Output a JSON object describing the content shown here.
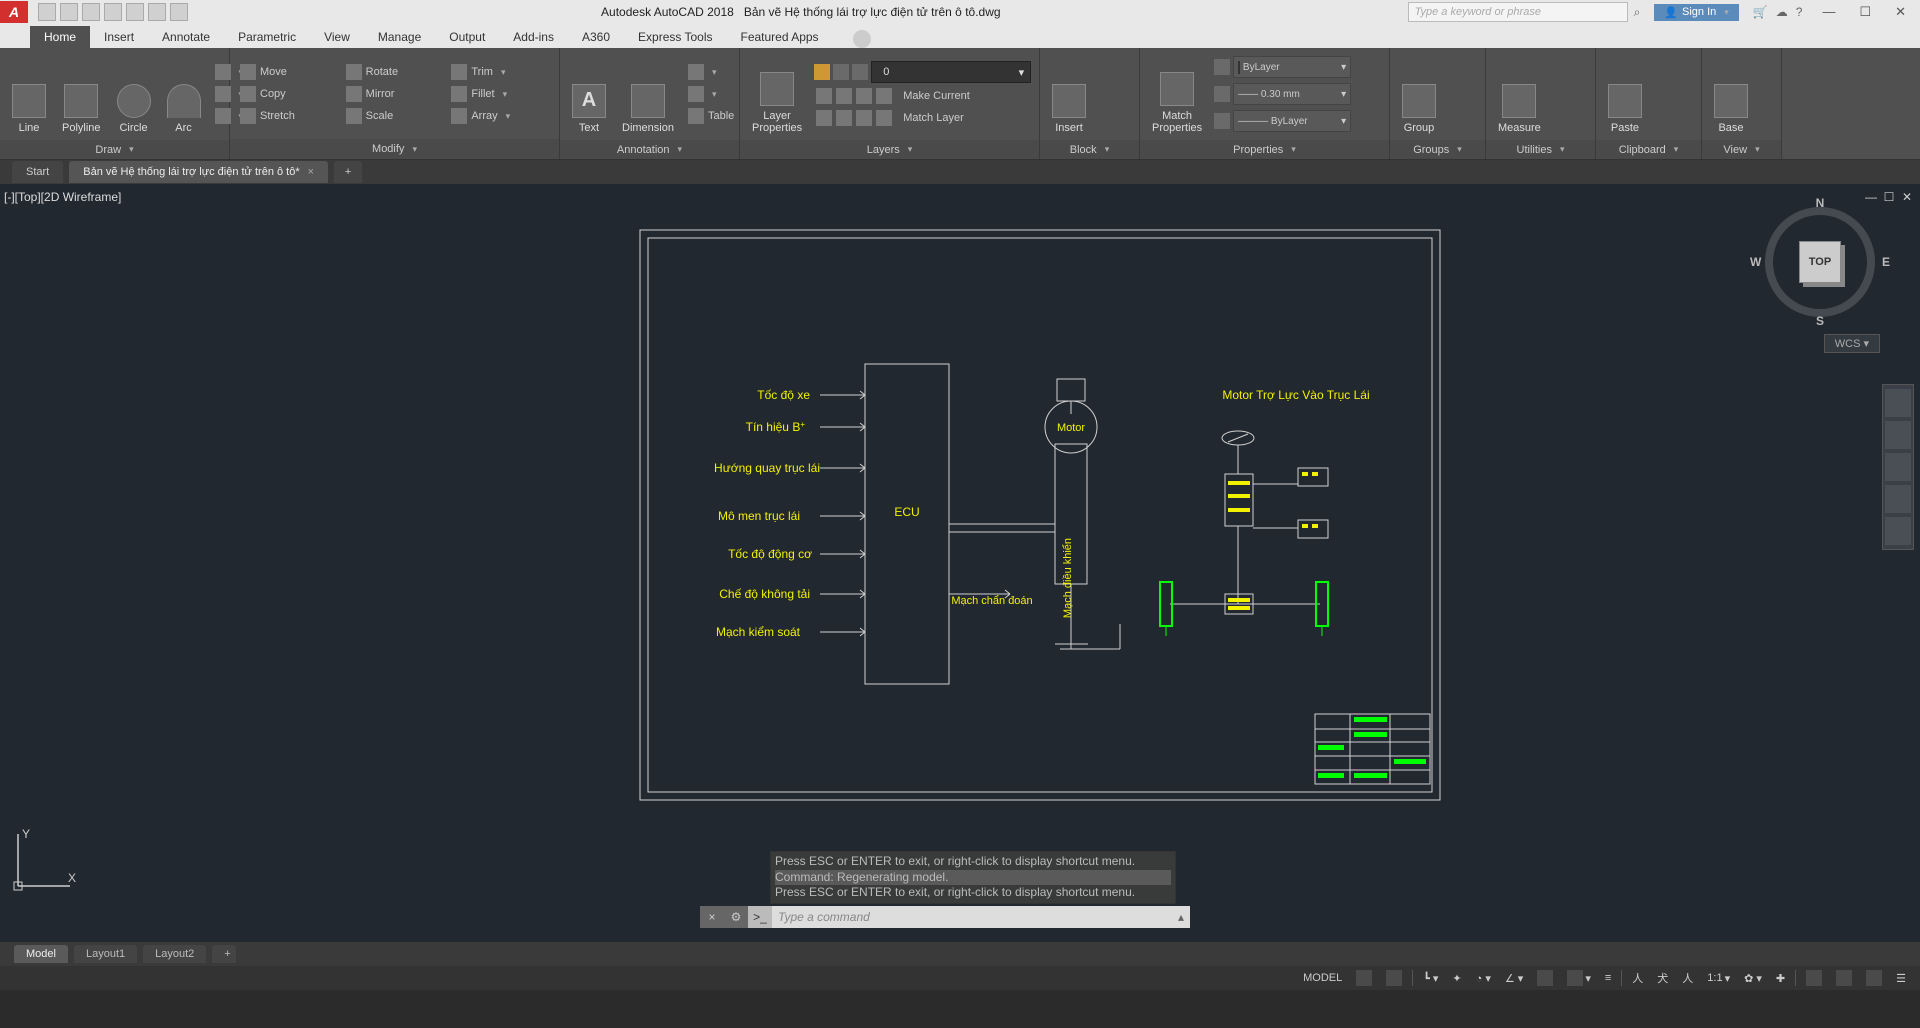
{
  "titlebar": {
    "app": "Autodesk AutoCAD 2018",
    "file": "Bản vẽ Hệ thống lái trợ lực điện tử trên ô tô.dwg",
    "search_placeholder": "Type a keyword or phrase",
    "signin": "Sign In"
  },
  "ribbon_tabs": [
    "Home",
    "Insert",
    "Annotate",
    "Parametric",
    "View",
    "Manage",
    "Output",
    "Add-ins",
    "A360",
    "Express Tools",
    "Featured Apps"
  ],
  "panels": {
    "draw": {
      "label": "Draw",
      "items": [
        "Line",
        "Polyline",
        "Circle",
        "Arc"
      ]
    },
    "modify": {
      "label": "Modify",
      "items": {
        "move": "Move",
        "rotate": "Rotate",
        "trim": "Trim",
        "copy": "Copy",
        "mirror": "Mirror",
        "fillet": "Fillet",
        "stretch": "Stretch",
        "scale": "Scale",
        "array": "Array"
      }
    },
    "annotation": {
      "label": "Annotation",
      "items": [
        "Text",
        "Dimension",
        "Table"
      ]
    },
    "layers": {
      "label": "Layers",
      "big": "Layer\nProperties",
      "current": "0",
      "actions": [
        "Make Current",
        "Match Layer"
      ]
    },
    "block": {
      "label": "Block",
      "big": "Insert"
    },
    "properties": {
      "label": "Properties",
      "big": "Match\nProperties",
      "bylayer": "ByLayer",
      "lw": "0.30 mm"
    },
    "groups": {
      "label": "Groups",
      "big": "Group"
    },
    "utilities": {
      "label": "Utilities",
      "big": "Measure"
    },
    "clipboard": {
      "label": "Clipboard",
      "big": "Paste"
    },
    "view": {
      "label": "View",
      "big": "Base"
    }
  },
  "filetabs": {
    "start": "Start",
    "doc": "Bản vẽ Hệ thống lái trợ lực điện tử trên ô tô*"
  },
  "viewport": {
    "label": "[-][Top][2D Wireframe]",
    "viewcube_top": "TOP",
    "wcs": "WCS"
  },
  "diagram": {
    "ecu": "ECU",
    "motor": "Motor",
    "control_circuit": "Mạch điều khiển",
    "diag_circuit": "Mạch chẩn đoán",
    "motor_assist": "Motor Trợ Lực Vào Trục Lái",
    "inputs": [
      "Tốc độ xe",
      "Tín hiệu B",
      "Hướng quay trục lái",
      "Mô men trục lái",
      "Tốc độ động cơ",
      "Chế độ không tải",
      "Mạch kiểm soát"
    ],
    "plus": "+"
  },
  "cmd": {
    "hist1": "Press ESC or ENTER to exit, or right-click to display shortcut menu.",
    "hist2": "Command: Regenerating model.",
    "hist3": "Press ESC or ENTER to exit, or right-click to display shortcut menu.",
    "prompt": "Type a command"
  },
  "layout_tabs": [
    "Model",
    "Layout1",
    "Layout2"
  ],
  "status": {
    "model": "MODEL",
    "scale": "1:1"
  }
}
